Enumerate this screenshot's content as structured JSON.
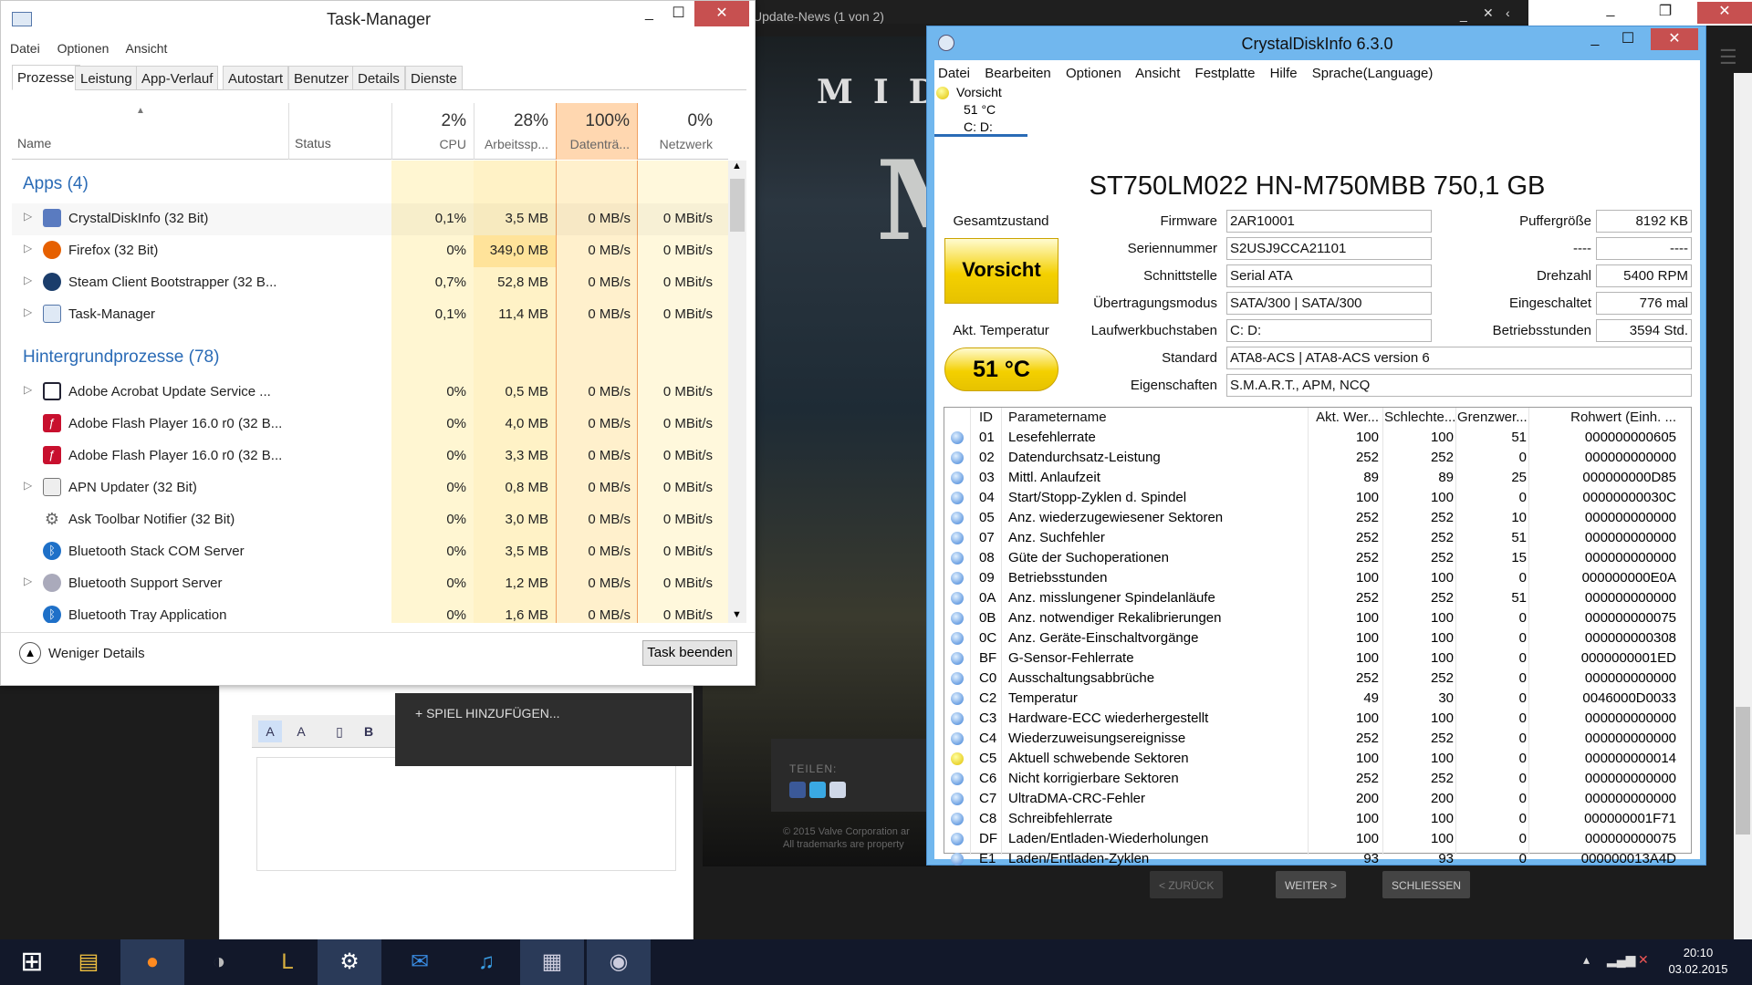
{
  "background": {
    "news_title": "Update-News (1 von 2)",
    "game_title": "MID",
    "game_letter": "M",
    "share_label": "TEILEN:",
    "copyright_1": "© 2015 Valve Corporation ar",
    "copyright_2": "All trademarks are property",
    "add_game": "+ SPIEL HINZUFÜGEN...",
    "wizard": {
      "back": "< ZURÜCK",
      "next": "WEITER >",
      "close": "SCHLIESSEN"
    },
    "editor_buttons": [
      "A",
      "A",
      "",
      "B"
    ]
  },
  "taskmanager": {
    "title": "Task-Manager",
    "menu": [
      "Datei",
      "Optionen",
      "Ansicht"
    ],
    "tabs": [
      "Prozesse",
      "Leistung",
      "App-Verlauf",
      "Autostart",
      "Benutzer",
      "Details",
      "Dienste"
    ],
    "columns": {
      "name": "Name",
      "status": "Status",
      "cpu_pct": "2%",
      "cpu": "CPU",
      "mem_pct": "28%",
      "mem": "Arbeitssp...",
      "disk_pct": "100%",
      "disk": "Datenträ...",
      "net_pct": "0%",
      "net": "Netzwerk"
    },
    "groups": {
      "apps": "Apps (4)",
      "background": "Hintergrundprozesse (78)"
    },
    "apps": [
      {
        "name": "CrystalDiskInfo (32 Bit)",
        "cpu": "0,1%",
        "mem": "3,5 MB",
        "disk": "0 MB/s",
        "net": "0 MBit/s"
      },
      {
        "name": "Firefox (32 Bit)",
        "cpu": "0%",
        "mem": "349,0 MB",
        "disk": "0 MB/s",
        "net": "0 MBit/s"
      },
      {
        "name": "Steam Client Bootstrapper (32 B...",
        "cpu": "0,7%",
        "mem": "52,8 MB",
        "disk": "0 MB/s",
        "net": "0 MBit/s"
      },
      {
        "name": "Task-Manager",
        "cpu": "0,1%",
        "mem": "11,4 MB",
        "disk": "0 MB/s",
        "net": "0 MBit/s"
      }
    ],
    "background_procs": [
      {
        "name": "Adobe Acrobat Update Service ...",
        "cpu": "0%",
        "mem": "0,5 MB",
        "disk": "0 MB/s",
        "net": "0 MBit/s"
      },
      {
        "name": "Adobe Flash Player 16.0 r0 (32 B...",
        "cpu": "0%",
        "mem": "4,0 MB",
        "disk": "0 MB/s",
        "net": "0 MBit/s"
      },
      {
        "name": "Adobe Flash Player 16.0 r0 (32 B...",
        "cpu": "0%",
        "mem": "3,3 MB",
        "disk": "0 MB/s",
        "net": "0 MBit/s"
      },
      {
        "name": "APN Updater (32 Bit)",
        "cpu": "0%",
        "mem": "0,8 MB",
        "disk": "0 MB/s",
        "net": "0 MBit/s"
      },
      {
        "name": "Ask Toolbar Notifier (32 Bit)",
        "cpu": "0%",
        "mem": "3,0 MB",
        "disk": "0 MB/s",
        "net": "0 MBit/s"
      },
      {
        "name": "Bluetooth Stack COM Server",
        "cpu": "0%",
        "mem": "3,5 MB",
        "disk": "0 MB/s",
        "net": "0 MBit/s"
      },
      {
        "name": "Bluetooth Support Server",
        "cpu": "0%",
        "mem": "1,2 MB",
        "disk": "0 MB/s",
        "net": "0 MBit/s"
      },
      {
        "name": "Bluetooth Tray Application",
        "cpu": "0%",
        "mem": "1,6 MB",
        "disk": "0 MB/s",
        "net": "0 MBit/s"
      }
    ],
    "footer": {
      "less": "Weniger Details",
      "end": "Task beenden"
    }
  },
  "cdi": {
    "title": "CrystalDiskInfo 6.3.0",
    "menu": [
      "Datei",
      "Bearbeiten",
      "Optionen",
      "Ansicht",
      "Festplatte",
      "Hilfe",
      "Sprache(Language)"
    ],
    "drive": {
      "status": "Vorsicht",
      "temp": "51 °C",
      "letters": "C: D:"
    },
    "model": "ST750LM022 HN-M750MBB 750,1 GB",
    "health_label": "Gesamtzustand",
    "health_value": "Vorsicht",
    "temp_label": "Akt. Temperatur",
    "temp_value": "51 °C",
    "fields": {
      "firmware_l": "Firmware",
      "firmware": "2AR10001",
      "serial_l": "Seriennummer",
      "serial": "S2USJ9CCA21101",
      "iface_l": "Schnittstelle",
      "iface": "Serial ATA",
      "mode_l": "Übertragungsmodus",
      "mode": "SATA/300 | SATA/300",
      "letters_l": "Laufwerkbuchstaben",
      "letters": "C: D:",
      "std_l": "Standard",
      "std": "ATA8-ACS | ATA8-ACS version 6",
      "feat_l": "Eigenschaften",
      "feat": "S.M.A.R.T., APM, NCQ",
      "buffer_l": "Puffergröße",
      "buffer": "8192 KB",
      "blank_l": "----",
      "blank": "----",
      "rpm_l": "Drehzahl",
      "rpm": "5400 RPM",
      "powon_l": "Eingeschaltet",
      "powon": "776 mal",
      "hours_l": "Betriebsstunden",
      "hours": "3594 Std."
    },
    "smart_header": {
      "id": "ID",
      "name": "Parametername",
      "cur": "Akt. Wer...",
      "worst": "Schlechte...",
      "thr": "Grenzwer...",
      "raw": "Rohwert (Einh. ..."
    },
    "smart": [
      {
        "id": "01",
        "name": "Lesefehlerrate",
        "cur": "100",
        "worst": "100",
        "thr": "51",
        "raw": "000000000605",
        "s": "b"
      },
      {
        "id": "02",
        "name": "Datendurchsatz-Leistung",
        "cur": "252",
        "worst": "252",
        "thr": "0",
        "raw": "000000000000",
        "s": "b"
      },
      {
        "id": "03",
        "name": "Mittl. Anlaufzeit",
        "cur": "89",
        "worst": "89",
        "thr": "25",
        "raw": "000000000D85",
        "s": "b"
      },
      {
        "id": "04",
        "name": "Start/Stopp-Zyklen d. Spindel",
        "cur": "100",
        "worst": "100",
        "thr": "0",
        "raw": "00000000030C",
        "s": "b"
      },
      {
        "id": "05",
        "name": "Anz. wiederzugewiesener Sektoren",
        "cur": "252",
        "worst": "252",
        "thr": "10",
        "raw": "000000000000",
        "s": "b"
      },
      {
        "id": "07",
        "name": "Anz. Suchfehler",
        "cur": "252",
        "worst": "252",
        "thr": "51",
        "raw": "000000000000",
        "s": "b"
      },
      {
        "id": "08",
        "name": "Güte der Suchoperationen",
        "cur": "252",
        "worst": "252",
        "thr": "15",
        "raw": "000000000000",
        "s": "b"
      },
      {
        "id": "09",
        "name": "Betriebsstunden",
        "cur": "100",
        "worst": "100",
        "thr": "0",
        "raw": "000000000E0A",
        "s": "b"
      },
      {
        "id": "0A",
        "name": "Anz. misslungener Spindelanläufe",
        "cur": "252",
        "worst": "252",
        "thr": "51",
        "raw": "000000000000",
        "s": "b"
      },
      {
        "id": "0B",
        "name": "Anz. notwendiger Rekalibrierungen",
        "cur": "100",
        "worst": "100",
        "thr": "0",
        "raw": "000000000075",
        "s": "b"
      },
      {
        "id": "0C",
        "name": "Anz. Geräte-Einschaltvorgänge",
        "cur": "100",
        "worst": "100",
        "thr": "0",
        "raw": "000000000308",
        "s": "b"
      },
      {
        "id": "BF",
        "name": "G-Sensor-Fehlerrate",
        "cur": "100",
        "worst": "100",
        "thr": "0",
        "raw": "0000000001ED",
        "s": "b"
      },
      {
        "id": "C0",
        "name": "Ausschaltungsabbrüche",
        "cur": "252",
        "worst": "252",
        "thr": "0",
        "raw": "000000000000",
        "s": "b"
      },
      {
        "id": "C2",
        "name": "Temperatur",
        "cur": "49",
        "worst": "30",
        "thr": "0",
        "raw": "0046000D0033",
        "s": "b"
      },
      {
        "id": "C3",
        "name": "Hardware-ECC wiederhergestellt",
        "cur": "100",
        "worst": "100",
        "thr": "0",
        "raw": "000000000000",
        "s": "b"
      },
      {
        "id": "C4",
        "name": "Wiederzuweisungsereignisse",
        "cur": "252",
        "worst": "252",
        "thr": "0",
        "raw": "000000000000",
        "s": "b"
      },
      {
        "id": "C5",
        "name": "Aktuell schwebende Sektoren",
        "cur": "100",
        "worst": "100",
        "thr": "0",
        "raw": "000000000014",
        "s": "y"
      },
      {
        "id": "C6",
        "name": "Nicht korrigierbare Sektoren",
        "cur": "252",
        "worst": "252",
        "thr": "0",
        "raw": "000000000000",
        "s": "b"
      },
      {
        "id": "C7",
        "name": "UltraDMA-CRC-Fehler",
        "cur": "200",
        "worst": "200",
        "thr": "0",
        "raw": "000000000000",
        "s": "b"
      },
      {
        "id": "C8",
        "name": "Schreibfehlerrate",
        "cur": "100",
        "worst": "100",
        "thr": "0",
        "raw": "000000001F71",
        "s": "b"
      },
      {
        "id": "DF",
        "name": "Laden/Entladen-Wiederholungen",
        "cur": "100",
        "worst": "100",
        "thr": "0",
        "raw": "000000000075",
        "s": "b"
      },
      {
        "id": "E1",
        "name": "Laden/Entladen-Zyklen",
        "cur": "93",
        "worst": "93",
        "thr": "0",
        "raw": "000000013A4D",
        "s": "b"
      }
    ]
  },
  "taskbar": {
    "time": "20:10",
    "date": "03.02.2015",
    "apps": [
      "start-icon",
      "explorer-icon",
      "firefox-icon",
      "media-icon",
      "league-icon",
      "steam-icon",
      "mail-icon",
      "itunes-icon",
      "taskmanager-icon",
      "crystaldiskinfo-icon"
    ]
  },
  "colors": {
    "accent": "#2a6bb6",
    "caution": "#f4d000",
    "cdi_frame": "#71b7ee",
    "disk_col": "#ffd7b0",
    "mem_col": "#fff0c0"
  }
}
